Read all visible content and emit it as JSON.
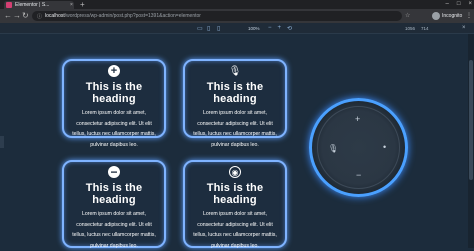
{
  "browser": {
    "tab_title": "Elementor | S...",
    "tab_close": "×",
    "new_tab": "+",
    "window_controls": [
      "–",
      "□",
      "×"
    ],
    "url_host": "localhost",
    "url_path": "/wordpress/wp-admin/post.php?post=1391&action=elementor",
    "incognito_label": "Incognito",
    "menu": "⋮"
  },
  "editor": {
    "zoom": "100%",
    "width": "1056",
    "height": "714"
  },
  "cards": [
    {
      "heading": "This is the heading",
      "text": "Lorem ipsum dolor sit amet, consectetur adipiscing elit. Ut elit tellus, luctus nec ullamcorper mattis, pulvinar dapibus leo.",
      "icon": "plus-circle-icon",
      "glyph": "+"
    },
    {
      "heading": "This is the heading",
      "text": "Lorem ipsum dolor sit amet, consectetur adipiscing elit. Ut elit tellus, luctus nec ullamcorper mattis, pulvinar dapibus leo.",
      "icon": "microphone-off-icon",
      "glyph": "🎙"
    },
    {
      "heading": "This is the heading",
      "text": "Lorem ipsum dolor sit amet, consectetur adipiscing elit. Ut elit tellus, luctus nec ullamcorper mattis, pulvinar dapibus leo.",
      "icon": "minus-circle-icon",
      "glyph": "−"
    },
    {
      "heading": "This is the heading",
      "text": "Lorem ipsum dolor sit amet, consectetur adipiscing elit. Ut elit tellus, luctus nec ullamcorper mattis, pulvinar dapibus leo.",
      "icon": "target-circle-icon",
      "glyph": "◉"
    }
  ],
  "echo": {
    "plus": "+",
    "minus": "−",
    "mic": "🎙",
    "dot": "•"
  },
  "colors": {
    "background": "#1c2c3c",
    "glow": "#7fb3ff",
    "ring": "#4aa0ff"
  }
}
